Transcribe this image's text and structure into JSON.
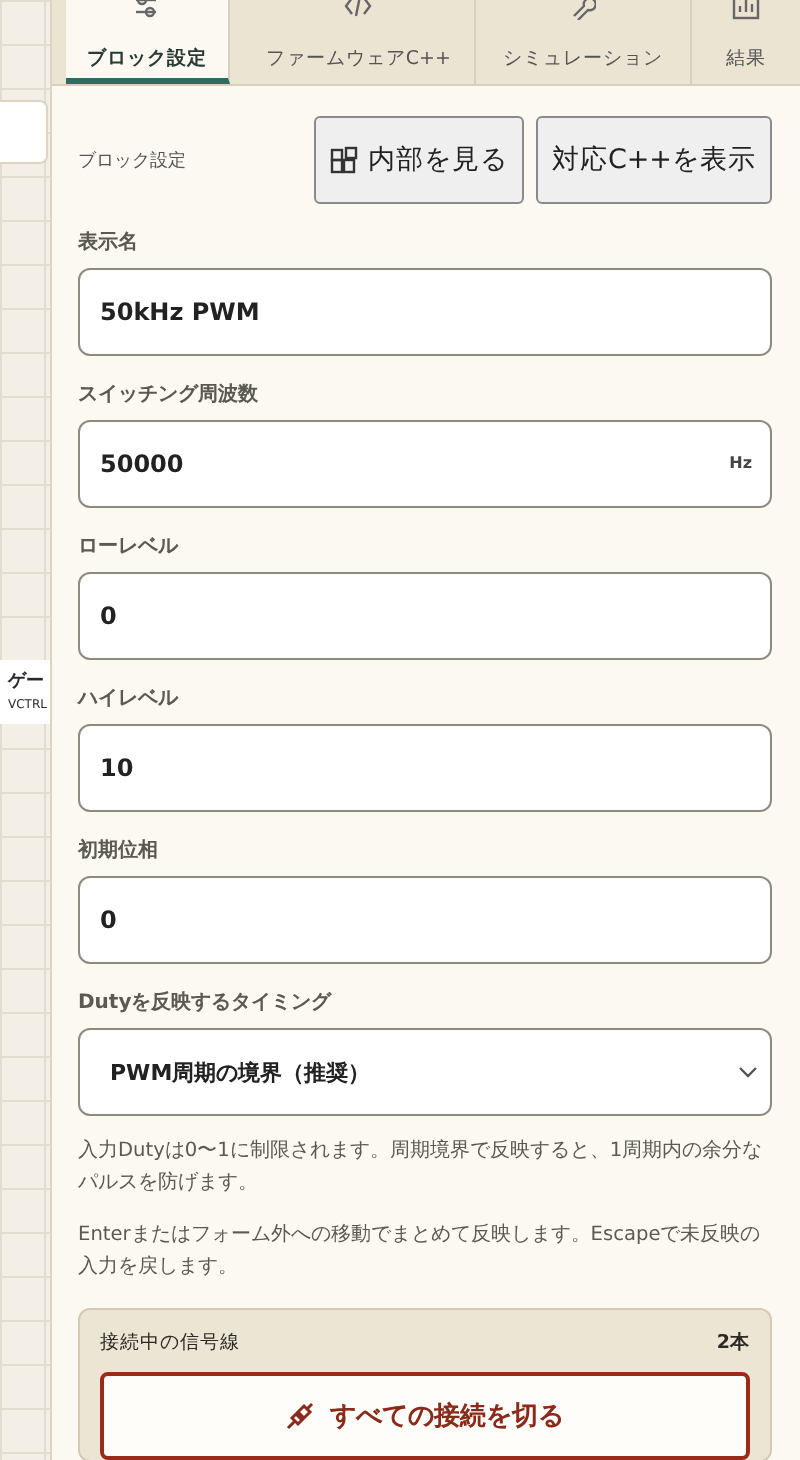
{
  "canvas": {
    "nodes": [
      {
        "title": "ゲー",
        "subtitle": "VCTRL"
      }
    ]
  },
  "tabs": [
    {
      "label": "ブロック設定",
      "selected": true
    },
    {
      "label": "ファームウェアC++",
      "selected": false
    },
    {
      "label": "シミュレーション",
      "selected": false
    },
    {
      "label": "結果",
      "selected": false
    }
  ],
  "header": {
    "title": "ブロック設定",
    "buttons": [
      {
        "label": "内部を見る"
      },
      {
        "label": "対応C++を表示"
      }
    ]
  },
  "fields": [
    {
      "kind": "text",
      "label": "表示名",
      "value": "50kHz PWM"
    },
    {
      "kind": "text",
      "label": "スイッチング周波数",
      "value": "50000",
      "unit": "Hz"
    },
    {
      "kind": "text",
      "label": "ローレベル",
      "value": "0"
    },
    {
      "kind": "text",
      "label": "ハイレベル",
      "value": "10"
    },
    {
      "kind": "text",
      "label": "初期位相",
      "value": "0"
    },
    {
      "kind": "select",
      "label": "Dutyを反映するタイミング",
      "value": "PWM周期の境界（推奨）"
    }
  ],
  "notes": [
    "入力Dutyは0〜1に制限されます。周期境界で反映すると、1周期内の余分なパルスを防げます。",
    "Enterまたはフォーム外への移動でまとめて反映します。Escapeで未反映の入力を戻します。"
  ],
  "connections": {
    "label": "接続中の信号線",
    "count": "2本",
    "button": "すべての接続を切る"
  }
}
